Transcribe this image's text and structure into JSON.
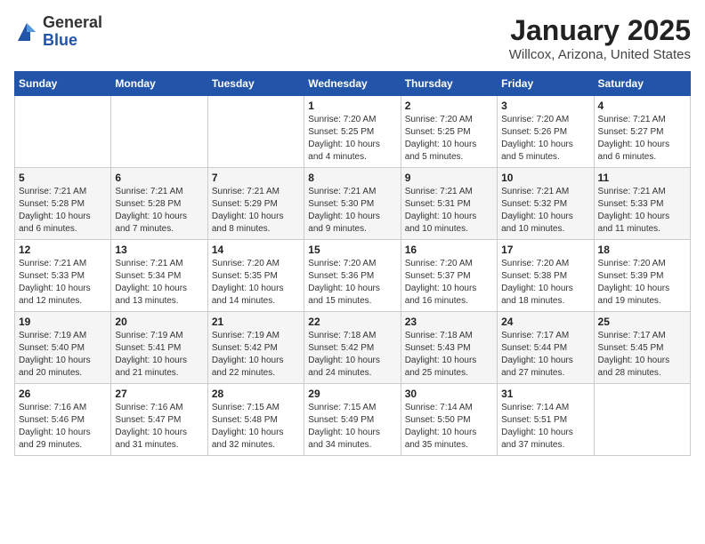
{
  "logo": {
    "general": "General",
    "blue": "Blue"
  },
  "title": "January 2025",
  "subtitle": "Willcox, Arizona, United States",
  "weekdays": [
    "Sunday",
    "Monday",
    "Tuesday",
    "Wednesday",
    "Thursday",
    "Friday",
    "Saturday"
  ],
  "weeks": [
    [
      {
        "day": "",
        "info": ""
      },
      {
        "day": "",
        "info": ""
      },
      {
        "day": "",
        "info": ""
      },
      {
        "day": "1",
        "info": "Sunrise: 7:20 AM\nSunset: 5:25 PM\nDaylight: 10 hours\nand 4 minutes."
      },
      {
        "day": "2",
        "info": "Sunrise: 7:20 AM\nSunset: 5:25 PM\nDaylight: 10 hours\nand 5 minutes."
      },
      {
        "day": "3",
        "info": "Sunrise: 7:20 AM\nSunset: 5:26 PM\nDaylight: 10 hours\nand 5 minutes."
      },
      {
        "day": "4",
        "info": "Sunrise: 7:21 AM\nSunset: 5:27 PM\nDaylight: 10 hours\nand 6 minutes."
      }
    ],
    [
      {
        "day": "5",
        "info": "Sunrise: 7:21 AM\nSunset: 5:28 PM\nDaylight: 10 hours\nand 6 minutes."
      },
      {
        "day": "6",
        "info": "Sunrise: 7:21 AM\nSunset: 5:28 PM\nDaylight: 10 hours\nand 7 minutes."
      },
      {
        "day": "7",
        "info": "Sunrise: 7:21 AM\nSunset: 5:29 PM\nDaylight: 10 hours\nand 8 minutes."
      },
      {
        "day": "8",
        "info": "Sunrise: 7:21 AM\nSunset: 5:30 PM\nDaylight: 10 hours\nand 9 minutes."
      },
      {
        "day": "9",
        "info": "Sunrise: 7:21 AM\nSunset: 5:31 PM\nDaylight: 10 hours\nand 10 minutes."
      },
      {
        "day": "10",
        "info": "Sunrise: 7:21 AM\nSunset: 5:32 PM\nDaylight: 10 hours\nand 10 minutes."
      },
      {
        "day": "11",
        "info": "Sunrise: 7:21 AM\nSunset: 5:33 PM\nDaylight: 10 hours\nand 11 minutes."
      }
    ],
    [
      {
        "day": "12",
        "info": "Sunrise: 7:21 AM\nSunset: 5:33 PM\nDaylight: 10 hours\nand 12 minutes."
      },
      {
        "day": "13",
        "info": "Sunrise: 7:21 AM\nSunset: 5:34 PM\nDaylight: 10 hours\nand 13 minutes."
      },
      {
        "day": "14",
        "info": "Sunrise: 7:20 AM\nSunset: 5:35 PM\nDaylight: 10 hours\nand 14 minutes."
      },
      {
        "day": "15",
        "info": "Sunrise: 7:20 AM\nSunset: 5:36 PM\nDaylight: 10 hours\nand 15 minutes."
      },
      {
        "day": "16",
        "info": "Sunrise: 7:20 AM\nSunset: 5:37 PM\nDaylight: 10 hours\nand 16 minutes."
      },
      {
        "day": "17",
        "info": "Sunrise: 7:20 AM\nSunset: 5:38 PM\nDaylight: 10 hours\nand 18 minutes."
      },
      {
        "day": "18",
        "info": "Sunrise: 7:20 AM\nSunset: 5:39 PM\nDaylight: 10 hours\nand 19 minutes."
      }
    ],
    [
      {
        "day": "19",
        "info": "Sunrise: 7:19 AM\nSunset: 5:40 PM\nDaylight: 10 hours\nand 20 minutes."
      },
      {
        "day": "20",
        "info": "Sunrise: 7:19 AM\nSunset: 5:41 PM\nDaylight: 10 hours\nand 21 minutes."
      },
      {
        "day": "21",
        "info": "Sunrise: 7:19 AM\nSunset: 5:42 PM\nDaylight: 10 hours\nand 22 minutes."
      },
      {
        "day": "22",
        "info": "Sunrise: 7:18 AM\nSunset: 5:42 PM\nDaylight: 10 hours\nand 24 minutes."
      },
      {
        "day": "23",
        "info": "Sunrise: 7:18 AM\nSunset: 5:43 PM\nDaylight: 10 hours\nand 25 minutes."
      },
      {
        "day": "24",
        "info": "Sunrise: 7:17 AM\nSunset: 5:44 PM\nDaylight: 10 hours\nand 27 minutes."
      },
      {
        "day": "25",
        "info": "Sunrise: 7:17 AM\nSunset: 5:45 PM\nDaylight: 10 hours\nand 28 minutes."
      }
    ],
    [
      {
        "day": "26",
        "info": "Sunrise: 7:16 AM\nSunset: 5:46 PM\nDaylight: 10 hours\nand 29 minutes."
      },
      {
        "day": "27",
        "info": "Sunrise: 7:16 AM\nSunset: 5:47 PM\nDaylight: 10 hours\nand 31 minutes."
      },
      {
        "day": "28",
        "info": "Sunrise: 7:15 AM\nSunset: 5:48 PM\nDaylight: 10 hours\nand 32 minutes."
      },
      {
        "day": "29",
        "info": "Sunrise: 7:15 AM\nSunset: 5:49 PM\nDaylight: 10 hours\nand 34 minutes."
      },
      {
        "day": "30",
        "info": "Sunrise: 7:14 AM\nSunset: 5:50 PM\nDaylight: 10 hours\nand 35 minutes."
      },
      {
        "day": "31",
        "info": "Sunrise: 7:14 AM\nSunset: 5:51 PM\nDaylight: 10 hours\nand 37 minutes."
      },
      {
        "day": "",
        "info": ""
      }
    ]
  ]
}
